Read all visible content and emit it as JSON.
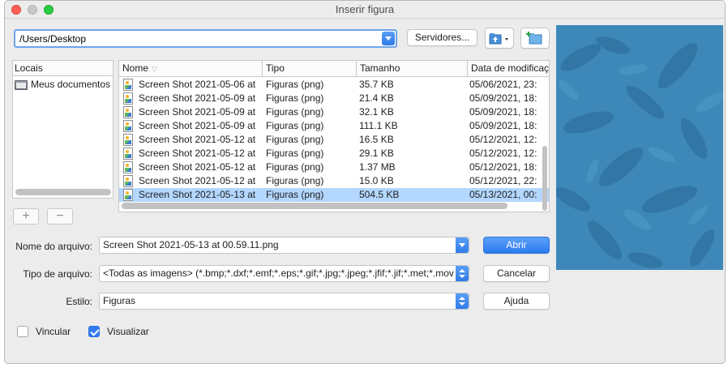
{
  "window": {
    "title": "Inserir figura"
  },
  "path": {
    "value": "/Users/Desktop"
  },
  "toolbar": {
    "servers_label": "Servidores..."
  },
  "places": {
    "header": "Locais",
    "items": [
      {
        "label": "Meus documentos"
      }
    ]
  },
  "columns": {
    "name": "Nome",
    "type": "Tipo",
    "size": "Tamanho",
    "modified": "Data de modificação"
  },
  "files": [
    {
      "name": "Screen Shot 2021-05-06 at",
      "type": "Figuras (png)",
      "size": "35.7 KB",
      "modified": "05/06/2021, 23:"
    },
    {
      "name": "Screen Shot 2021-05-09 at",
      "type": "Figuras (png)",
      "size": "21.4 KB",
      "modified": "05/09/2021, 18:"
    },
    {
      "name": "Screen Shot 2021-05-09 at",
      "type": "Figuras (png)",
      "size": "32.1 KB",
      "modified": "05/09/2021, 18:"
    },
    {
      "name": "Screen Shot 2021-05-09 at",
      "type": "Figuras (png)",
      "size": "111.1 KB",
      "modified": "05/09/2021, 18:"
    },
    {
      "name": "Screen Shot 2021-05-12 at",
      "type": "Figuras (png)",
      "size": "16.5 KB",
      "modified": "05/12/2021, 12:"
    },
    {
      "name": "Screen Shot 2021-05-12 at",
      "type": "Figuras (png)",
      "size": "29.1 KB",
      "modified": "05/12/2021, 12:"
    },
    {
      "name": "Screen Shot 2021-05-12 at",
      "type": "Figuras (png)",
      "size": "1.37 MB",
      "modified": "05/12/2021, 18:"
    },
    {
      "name": "Screen Shot 2021-05-12 at",
      "type": "Figuras (png)",
      "size": "15.0 KB",
      "modified": "05/12/2021, 22:"
    },
    {
      "name": "Screen Shot 2021-05-13 at",
      "type": "Figuras (png)",
      "size": "504.5 KB",
      "modified": "05/13/2021, 00:"
    }
  ],
  "selected_index": 8,
  "form": {
    "filename_label": "Nome do arquivo:",
    "filename_value": "Screen Shot 2021-05-13 at 00.59.11.png",
    "filetype_label": "Tipo de arquivo:",
    "filetype_value": "<Todas as imagens> (*.bmp;*.dxf;*.emf;*.eps;*.gif;*.jpg;*.jpeg;*.jfif;*.jif;*.met;*.mov",
    "style_label": "Estilo:",
    "style_value": "Figuras"
  },
  "buttons": {
    "open": "Abrir",
    "cancel": "Cancelar",
    "help": "Ajuda"
  },
  "options": {
    "link_label": "Vincular",
    "link_checked": false,
    "preview_label": "Visualizar",
    "preview_checked": true
  },
  "colors": {
    "accent": "#2f7be8",
    "selection": "#b3d7ff",
    "preview_bg": "#3b87b7"
  }
}
